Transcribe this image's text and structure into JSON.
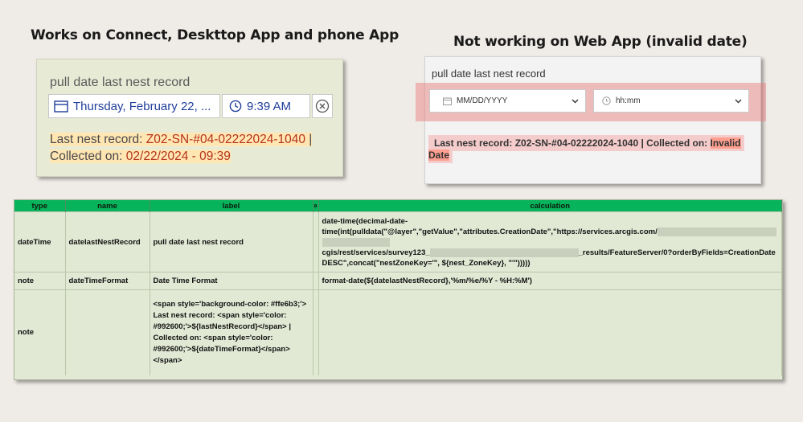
{
  "titles": {
    "left": "Works on Connect, Deskttop App and phone App",
    "right": "Not working on Web App (invalid date)"
  },
  "left_panel": {
    "question_label": "pull date last nest record",
    "date_value": "Thursday, February 22, ...",
    "time_value": "9:39 AM",
    "note_prefix": "Last nest record: ",
    "note_record": "Z02-SN-#04-02222024-1040",
    "note_sep": " | ",
    "note_collected": "Collected on: ",
    "note_date": "02/22/2024 - 09:39"
  },
  "right_panel": {
    "question_label": "pull date last nest record",
    "date_placeholder": "MM/DD/YYYY",
    "time_placeholder": "hh:mm",
    "note_text": "Last nest record: Z02-SN-#04-02222024-1040 | Collected on: ",
    "invalid_part1": "Invalid",
    "invalid_part2": "Date"
  },
  "table": {
    "headers": [
      "type",
      "name",
      "label",
      "a",
      "calculation"
    ],
    "rows": [
      {
        "type": "dateTime",
        "name": "datelastNestRecord",
        "label": "pull date last nest record",
        "calc_1": "date-time(decimal-date-\ntime(int(pulldata(\"@layer\",\"getValue\",\"attributes.CreationDate\",\"https://services.arcgis.com/",
        "calc_2": "cgis/rest/services/survey123_",
        "calc_3": "_results/FeatureServer/0?orderByFields=CreationDate DESC\",concat(\"nestZoneKey='\", ${nest_ZoneKey}, \"'\")))))"
      },
      {
        "type": "note",
        "name": "dateTimeFormat",
        "label": "Date Time Format",
        "calc": "format-date(${datelastNestRecord},'%m/%e/%Y - %H:%M')"
      },
      {
        "type": "note",
        "name": "",
        "label": "<span style='background-color: #ffe6b3;'>  Last nest record: <span style='color: #992600;'>${lastNestRecord}</span> | Collected on: <span style='color: #992600;'>${dateTimeFormat}</span></span>",
        "calc": ""
      }
    ]
  },
  "colors": {
    "header_green": "#07b35b",
    "note_highlight": "#ffe6b3",
    "note_red": "#992600",
    "date_blue": "#213f9a"
  }
}
